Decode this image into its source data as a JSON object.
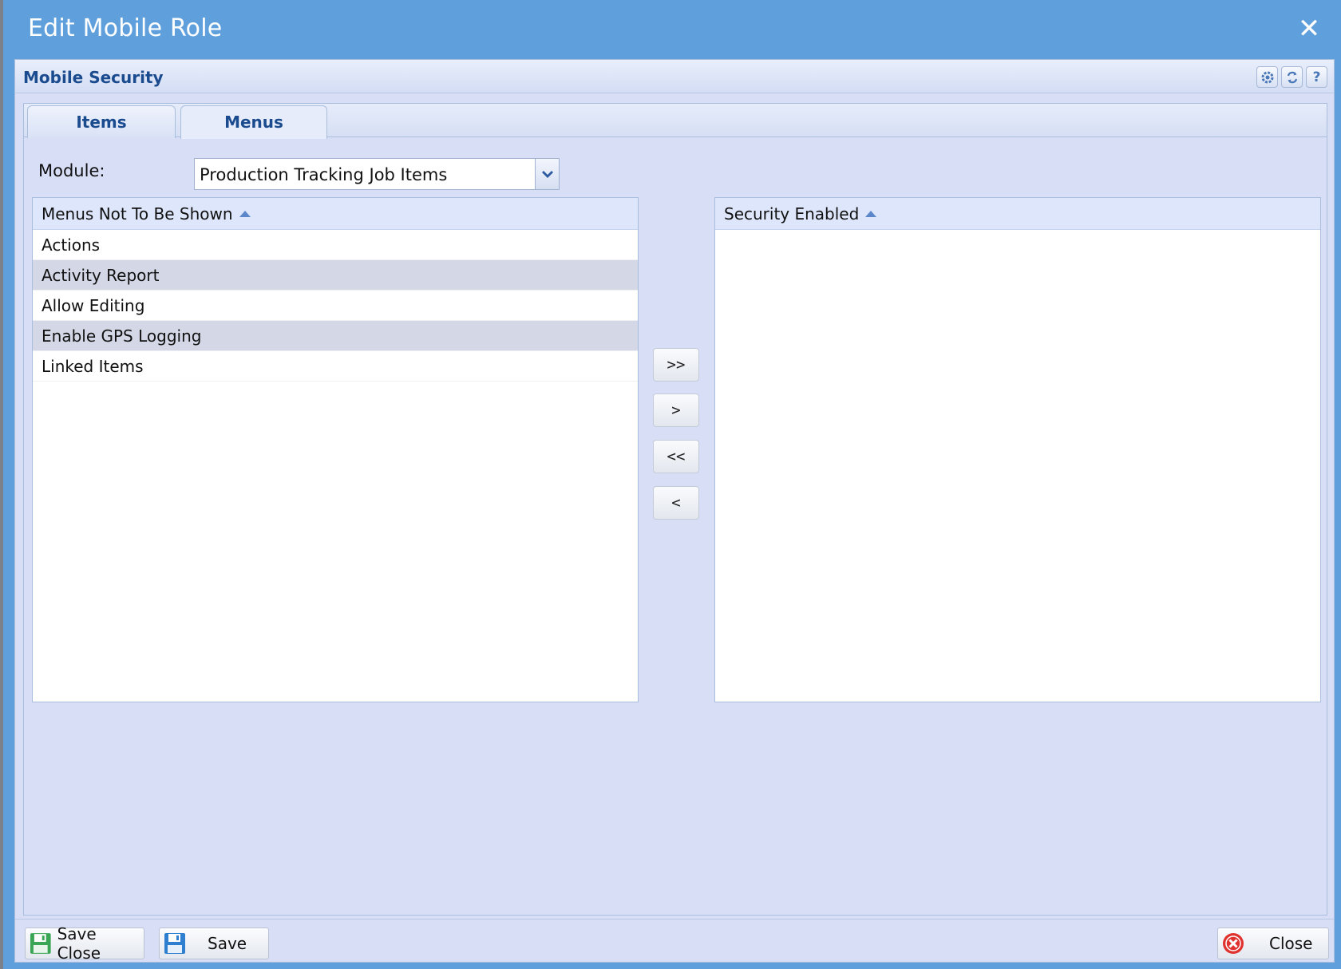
{
  "window": {
    "title": "Edit Mobile Role"
  },
  "panel": {
    "title": "Mobile Security"
  },
  "tabs": [
    {
      "label": "Items",
      "active": false
    },
    {
      "label": "Menus",
      "active": true
    }
  ],
  "module": {
    "label": "Module:",
    "value": "Production Tracking Job Items"
  },
  "left_grid": {
    "header": "Menus Not To Be Shown",
    "rows": [
      "Actions",
      "Activity Report",
      "Allow Editing",
      "Enable GPS Logging",
      "Linked Items"
    ]
  },
  "right_grid": {
    "header": "Security Enabled",
    "rows": []
  },
  "move_buttons": {
    "move_all_right": ">>",
    "move_right": ">",
    "move_all_left": "<<",
    "move_left": "<"
  },
  "footer": {
    "save_close": "Save Close",
    "save": "Save",
    "close": "Close"
  },
  "colors": {
    "title_bar": "#5fa0dc",
    "panel_bg": "#d7def6",
    "accent_text": "#1b4b8f",
    "selected_row": "#d4d8e6"
  }
}
